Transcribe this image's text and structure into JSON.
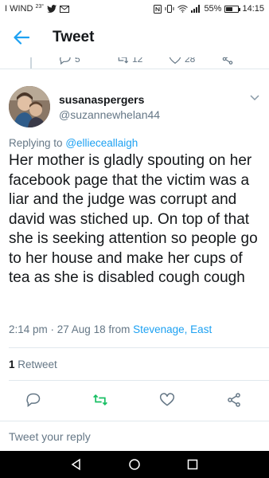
{
  "status_bar": {
    "carrier": "I WIND",
    "temperature": "23°",
    "signal_strength": "55%",
    "time": "14:15",
    "battery_level": 0.55
  },
  "header": {
    "title": "Tweet"
  },
  "parent_tweet_actions": {
    "replies": "5",
    "retweets": "12",
    "likes": "28"
  },
  "tweet": {
    "author_name": "susanaspergers",
    "author_handle": "@suzannewhelan44",
    "replying_prefix": "Replying to",
    "replying_to": "@ellieceallaigh",
    "text": "Her mother is gladly spouting on her facebook page that the victim was a liar and the judge was corrupt and david was stiched up. On top of that she is seeking attention so people go to her house and make her cups of tea as she is disabled cough cough",
    "timestamp": "2:14 pm · 27 Aug 18",
    "from_prefix": "from",
    "location": "Stevenage, East",
    "retweet_count": "1",
    "retweet_label": "Retweet"
  },
  "reply_bar": {
    "placeholder": "Tweet your reply"
  },
  "colors": {
    "accent": "#1da1f2",
    "retweet_green": "#17bf63",
    "muted": "#657786",
    "text": "#14171a"
  }
}
